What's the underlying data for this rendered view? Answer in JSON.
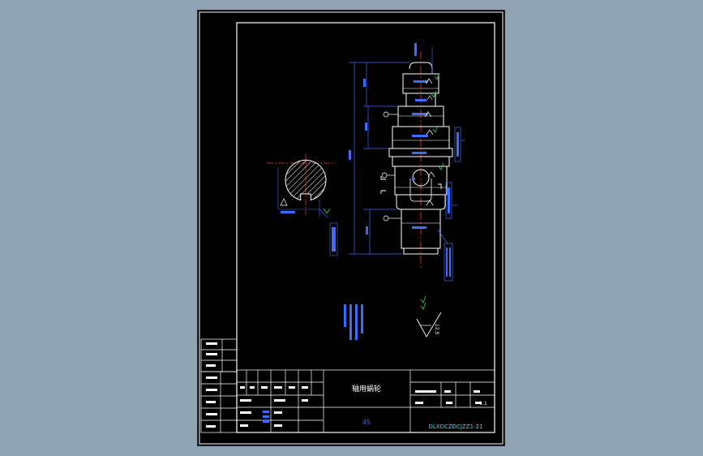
{
  "drawing": {
    "title": "轴用蜗轮",
    "material": "45",
    "drawing_number": "DLXDCZDCJZZ1-21",
    "scale": "1:1",
    "roughness_symbol_value": "12.5",
    "colors": {
      "background": "#8fa3b5",
      "sheet": "#000000",
      "border": "#ffffff",
      "part_outline": "#ffffff",
      "dimension": "#3b6cff",
      "centerline": "#ff3333",
      "hatch": "#ffffff",
      "callout_green": "#2bd14a",
      "drawing_number": "#38e0ff"
    }
  }
}
